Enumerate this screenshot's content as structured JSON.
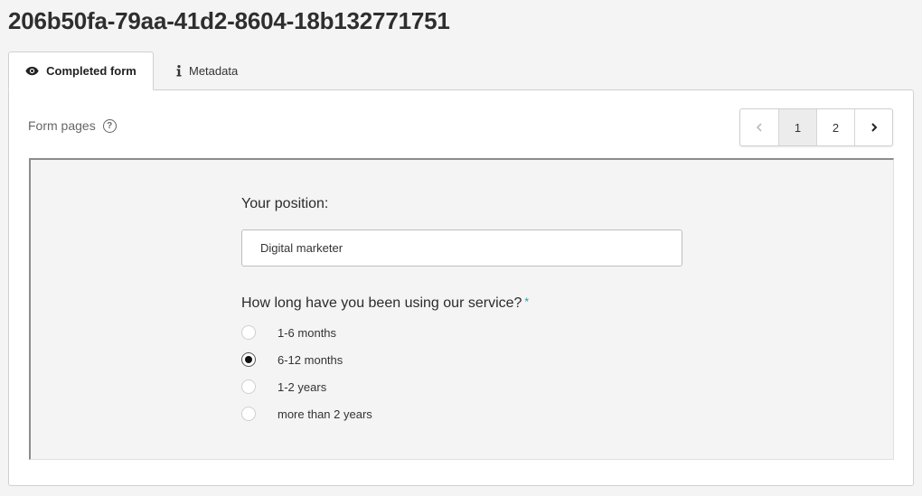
{
  "page": {
    "title": "206b50fa-79aa-41d2-8604-18b132771751"
  },
  "tabs": [
    {
      "label": "Completed form",
      "icon": "eye-icon",
      "active": true
    },
    {
      "label": "Metadata",
      "icon": "info-icon",
      "active": false
    }
  ],
  "form_pages": {
    "label": "Form pages",
    "help_icon": "help-icon",
    "pager": {
      "prev_icon": "chevron-left-icon",
      "next_icon": "chevron-right-icon",
      "pages": [
        "1",
        "2"
      ],
      "current": "1"
    }
  },
  "form": {
    "position": {
      "label": "Your position:",
      "value": "Digital marketer"
    },
    "usage": {
      "label": "How long have you been using our service?",
      "required_marker": "*",
      "options": [
        "1-6 months",
        "6-12 months",
        "1-2 years",
        "more than 2 years"
      ],
      "selected": "6-12 months"
    }
  }
}
